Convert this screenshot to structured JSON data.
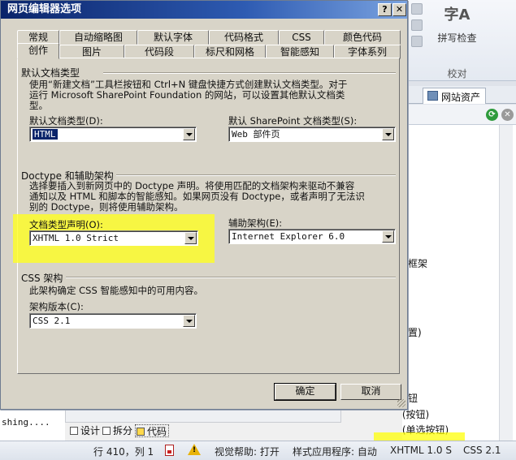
{
  "dialog": {
    "title": "网页编辑器选项",
    "help_btn": "?",
    "close_btn": "✕",
    "tabs_row1": [
      "常规",
      "自动缩略图",
      "默认字体",
      "代码格式",
      "CSS",
      "颜色代码"
    ],
    "tabs_row2": [
      "创作",
      "图片",
      "代码段",
      "标尺和网格",
      "智能感知",
      "字体系列"
    ],
    "active_tab": "创作",
    "section_default": {
      "title": "默认文档类型",
      "desc_line1": "使用“新建文档”工具栏按钮和 Ctrl+N 键盘快捷方式创建默认文档类型。对于",
      "desc_line2": "运行 Microsoft SharePoint Foundation 的网站，可以设置其他默认文档类",
      "desc_line3": "型。",
      "doc_type_label": "默认文档类型(D):",
      "doc_type_value": "HTML",
      "sp_type_label": "默认 SharePoint 文档类型(S):",
      "sp_type_value": "Web 部件页"
    },
    "section_doctype": {
      "title": "Doctype 和辅助架构",
      "desc_line1": "选择要插入到新网页中的 Doctype 声明。将使用匹配的文档架构来驱动不兼容",
      "desc_line2": "通知以及 HTML 和脚本的智能感知。如果网页没有 Doctype，或者声明了无法识",
      "desc_line3": "别的 Doctype，则将使用辅助架构。",
      "decl_label": "文档类型声明(O):",
      "decl_value": "XHTML 1.0 Strict",
      "aux_label": "辅助架构(E):",
      "aux_value": "Internet Explorer 6.0"
    },
    "section_css": {
      "title": "CSS 架构",
      "desc": "此架构确定 CSS 智能感知中的可用内容。",
      "version_label": "架构版本(C):",
      "version_value": "CSS 2.1"
    },
    "ok_label": "确定",
    "cancel_label": "取消"
  },
  "background": {
    "spell_glyph": "字A",
    "spell_label": "拼写检查",
    "proofing_group": "校对",
    "site_assets_tab": "网站资产",
    "frag_frame": "框架",
    "frag_position": "置)",
    "frag_button": "钮",
    "list_items": [
      "输入 (按钮)",
      "输入 (单选按钮)"
    ],
    "code_text": "shing....",
    "view_buttons": [
      "设计",
      "拆分",
      "代码"
    ],
    "active_view": "代码"
  },
  "status": {
    "position": "行 410，列 1",
    "visual_aids": "视觉帮助: 打开",
    "style_app": "样式应用程序: 自动",
    "doctype": "XHTML 1.0 S",
    "css": "CSS 2.1"
  },
  "colors": {
    "highlight": "#ffff1e",
    "title_bar": "#0a246a",
    "dialog_bg": "#d8d4c8"
  }
}
